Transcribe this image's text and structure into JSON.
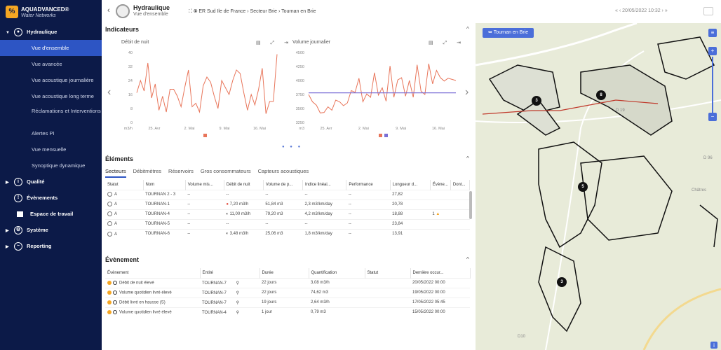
{
  "brand": {
    "name": "AQUADVANCED®",
    "sub": "Water Networks"
  },
  "nav": {
    "hydraulique": "Hydraulique",
    "sub": [
      "Vue d'ensemble",
      "Vue avancée",
      "Vue acoustique journalière",
      "Vue acoustique long terme",
      "Réclamations et Interventions",
      "Alertes PI",
      "Vue mensuelle",
      "Synoptique dynamique"
    ],
    "qualite": "Qualité",
    "evenements": "Évènements",
    "espace": "Espace de travail",
    "systeme": "Système",
    "reporting": "Reporting"
  },
  "header": {
    "title": "Hydraulique",
    "subtitle": "Vue d'ensemble",
    "breadcrumb": "ER Sud Ile de France  ›  Secteur Brie  ›  Tournan en Brie",
    "date": "«  ‹  20/05/2022 10:32  ›  »"
  },
  "indicateurs": {
    "title": "Indicateurs",
    "c1": {
      "title": "Débit de nuit",
      "unit": "m3/h",
      "y": [
        "40",
        "32",
        "24",
        "16",
        "8",
        "0"
      ],
      "x": [
        "25. Avr",
        "2. Mai",
        "9. Mai",
        "16. Mai"
      ]
    },
    "c2": {
      "title": "Volume journalier",
      "unit": "m3",
      "y": [
        "4500",
        "4250",
        "4000",
        "3750",
        "3500",
        "3250"
      ],
      "x": [
        "25. Avr",
        "2. Mai",
        "9. Mai",
        "16. Mai"
      ]
    }
  },
  "chart_data": [
    {
      "type": "line",
      "title": "Débit de nuit",
      "ylabel": "m3/h",
      "ylim": [
        0,
        40
      ],
      "x": [
        "25. Avr",
        "2. Mai",
        "9. Mai",
        "16. Mai"
      ],
      "series": [
        {
          "values": [
            17,
            24,
            18,
            34,
            14,
            22,
            7,
            15,
            6,
            19,
            19,
            15,
            9,
            20,
            30,
            9,
            11,
            6,
            21,
            26,
            23,
            15,
            8,
            24,
            20,
            16,
            24,
            30,
            28,
            17,
            7,
            16,
            10,
            19,
            31,
            5,
            12,
            12,
            39
          ]
        }
      ]
    },
    {
      "type": "line",
      "title": "Volume journalier",
      "ylabel": "m3",
      "ylim": [
        3250,
        4500
      ],
      "x": [
        "25. Avr",
        "2. Mai",
        "9. Mai",
        "16. Mai"
      ],
      "series": [
        {
          "values": [
            3750,
            3620,
            3560,
            3420,
            3430,
            3530,
            3470,
            3650,
            3620,
            3550,
            3600,
            3820,
            3790,
            4040,
            3620,
            3760,
            3700,
            4140,
            3740,
            3870,
            3630,
            4260,
            3700,
            4010,
            4050,
            3720,
            4000,
            3700,
            4280,
            3810,
            3750,
            4300,
            3940,
            4180,
            4050,
            3990,
            4040,
            4020,
            4000
          ]
        },
        {
          "values": [
            3780,
            3780,
            3780,
            3780,
            3780,
            3780,
            3780,
            3780,
            3780,
            3780,
            3780,
            3780,
            3780,
            3780,
            3780,
            3780,
            3780,
            3780,
            3780,
            3780,
            3780,
            3780,
            3780,
            3780,
            3780,
            3780,
            3780,
            3780,
            3780,
            3780,
            3780,
            3780,
            3780,
            3780,
            3780,
            3780,
            3780,
            3780,
            3780
          ]
        }
      ]
    }
  ],
  "elements": {
    "title": "Éléments",
    "tabs": [
      "Secteurs",
      "Débitmètres",
      "Réservoirs",
      "Gros consommateurs",
      "Capteurs acoustiques"
    ],
    "cols": [
      "Statut",
      "Nom",
      "Volume mis...",
      "Débit de nuit",
      "Volume de p...",
      "Indice linéai...",
      "Performance",
      "Longueur d...",
      "Évène...",
      "Dont..."
    ],
    "rows": [
      [
        "A",
        "TOURNAN 2 - 3",
        "--",
        "--",
        "--",
        "--",
        "--",
        "27,82",
        "",
        ""
      ],
      [
        "A",
        "TOURNAN-1",
        "--",
        "7,20 m3/h",
        "51,84 m3",
        "2,3 m3/km/day",
        "--",
        "20,78",
        "",
        ""
      ],
      [
        "A",
        "TOURNAN-4",
        "--",
        "11,00 m3/h",
        "79,20 m3",
        "4,2 m3/km/day",
        "--",
        "18,88",
        "1",
        ""
      ],
      [
        "A",
        "TOURNAN-5",
        "--",
        "--",
        "--",
        "--",
        "--",
        "23,84",
        "",
        ""
      ],
      [
        "A",
        "TOURNAN-6",
        "--",
        "3,48 m3/h",
        "25,06 m3",
        "1,8 m3/km/day",
        "--",
        "13,91",
        "",
        ""
      ]
    ]
  },
  "evenement": {
    "title": "Évènement",
    "cols": [
      "Évènement",
      "Entité",
      "Durée",
      "Quantification",
      "Statut",
      "Dernière occur..."
    ],
    "rows": [
      [
        "Débit de nuit élevé",
        "TOURNAN-7",
        "22 jours",
        "3,08 m3/h",
        "",
        "20/05/2022 00:00"
      ],
      [
        "Volume quotidien livré élevé",
        "TOURNAN-7",
        "22 jours",
        "74,62 m3",
        "",
        "19/05/2022 00:00"
      ],
      [
        "Débit livré en hausse (S)",
        "TOURNAN-7",
        "19 jours",
        "2,64 m3/h",
        "",
        "17/05/2022 05:45"
      ],
      [
        "Volume quotidien livré élevé",
        "TOURNAN-4",
        "1 jour",
        "0,79 m3",
        "",
        "15/05/2022 00:00"
      ]
    ]
  },
  "map": {
    "chip": "Tournan en Brie",
    "markers": [
      "3",
      "8",
      "5",
      "3"
    ],
    "labels": [
      "Châtres",
      "D 96",
      "D10",
      "D 19"
    ]
  },
  "colors": {
    "sidebar": "#0c1a48",
    "accent": "#2d55c4",
    "line": "#e8755a",
    "ref": "#7a6fd6"
  }
}
